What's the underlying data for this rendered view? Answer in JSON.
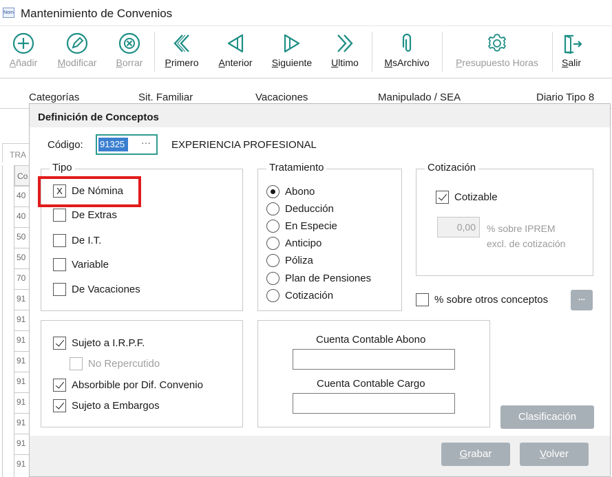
{
  "window": {
    "icon_text": "Nom",
    "title": "Mantenimiento de Convenios"
  },
  "toolbar": {
    "buttons": [
      {
        "label": "Añadir",
        "icon": "plus-circle-icon",
        "enabled": false
      },
      {
        "label": "Modificar",
        "icon": "pencil-circle-icon",
        "enabled": false
      },
      {
        "label": "Borrar",
        "icon": "x-circle-icon",
        "enabled": false
      },
      {
        "label": "Primero",
        "icon": "double-chevron-left-icon",
        "enabled": true
      },
      {
        "label": "Anterior",
        "icon": "triangle-left-icon",
        "enabled": true
      },
      {
        "label": "Siguiente",
        "icon": "triangle-right-icon",
        "enabled": true
      },
      {
        "label": "Ultimo",
        "icon": "double-chevron-right-icon",
        "enabled": true
      },
      {
        "label": "MsArchivo",
        "icon": "paperclip-icon",
        "enabled": true
      },
      {
        "label": "Presupuesto Horas",
        "icon": "gear-icon",
        "enabled": false
      },
      {
        "label": "Salir",
        "icon": "exit-door-icon",
        "enabled": true
      }
    ]
  },
  "category_tabs": [
    "Categorías",
    "Sit. Familiar",
    "Vacaciones",
    "Manipulado / SEA",
    "Diario Tipo 8"
  ],
  "background_grid": {
    "tab_stub": "TRA",
    "header": "Co",
    "rows": [
      "40",
      "40",
      "50",
      "50",
      "70",
      "91",
      "91",
      "91",
      "91",
      "91",
      "91",
      "91",
      "91",
      "91"
    ]
  },
  "dialog": {
    "title": "Definición de Conceptos",
    "codigo": {
      "label": "Código:",
      "value": "91325",
      "lookup": "···",
      "description": "EXPERIENCIA PROFESIONAL"
    },
    "tipo": {
      "legend": "Tipo",
      "options": [
        {
          "label": "De Nómina",
          "mark": "X"
        },
        {
          "label": "De Extras",
          "mark": ""
        },
        {
          "label": "De I.T.",
          "mark": ""
        },
        {
          "label": "Variable",
          "mark": ""
        },
        {
          "label": "De Vacaciones",
          "mark": ""
        }
      ]
    },
    "tratamiento": {
      "legend": "Tratamiento",
      "options": [
        "Abono",
        "Deducción",
        "En Especie",
        "Anticipo",
        "Póliza",
        "Plan de Pensiones",
        "Cotización"
      ],
      "selected": "Abono"
    },
    "cotizacion": {
      "legend": "Cotización",
      "cotizable_label": "Cotizable",
      "cotizable_checked": true,
      "iprem_value": "0,00",
      "iprem_caption_1": "% sobre IPREM",
      "iprem_caption_2": "excl. de cotización"
    },
    "otros": {
      "label": "% sobre otros conceptos",
      "checked": false,
      "button": "..."
    },
    "flags": [
      {
        "label": "Sujeto a I.R.P.F.",
        "checked": true,
        "enabled": true
      },
      {
        "label": "No Repercutido",
        "checked": false,
        "enabled": false
      },
      {
        "label": "Absorbible por Dif. Convenio",
        "checked": true,
        "enabled": true
      },
      {
        "label": "Sujeto a Embargos",
        "checked": true,
        "enabled": true
      }
    ],
    "cuentas": {
      "abono_label": "Cuenta Contable Abono",
      "abono_value": "",
      "cargo_label": "Cuenta Contable Cargo",
      "cargo_value": ""
    },
    "buttons": {
      "clasificacion": "Clasificación",
      "grabar_first": "G",
      "grabar_rest": "rabar",
      "volver_first": "V",
      "volver_rest": "olver"
    }
  },
  "colors": {
    "highlight": "#e21b1b",
    "icon_teal": "#1f8f86",
    "selection_blue": "#3a7fd0",
    "disabled_button": "#a8b0b7"
  }
}
